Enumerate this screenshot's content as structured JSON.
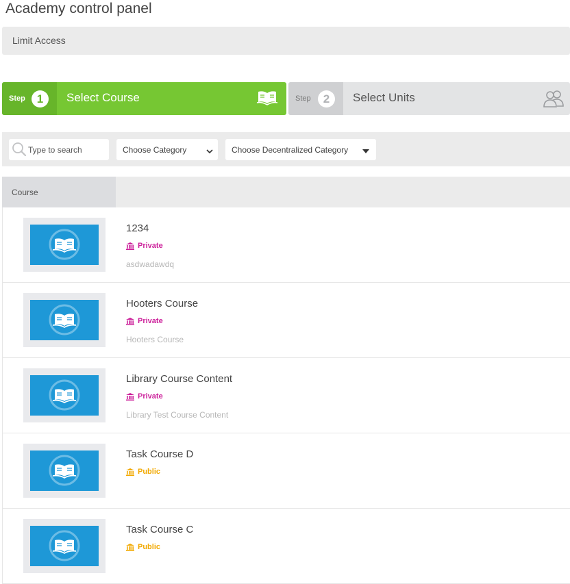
{
  "page": {
    "title": "Academy control panel"
  },
  "section": {
    "label": "Limit Access"
  },
  "steps": [
    {
      "word": "Step",
      "number": "1",
      "label": "Select Course",
      "icon": "open-book-icon",
      "active": true
    },
    {
      "word": "Step",
      "number": "2",
      "label": "Select Units",
      "icon": "users-icon",
      "active": false
    }
  ],
  "filters": {
    "search_placeholder": "Type to search",
    "category_selected": "Choose Category",
    "decentralized_selected": "Choose Decentralized Category"
  },
  "table": {
    "header_course": "Course"
  },
  "courses": [
    {
      "title": "1234",
      "visibility": "Private",
      "subtitle": "asdwadawdq"
    },
    {
      "title": "Hooters Course",
      "visibility": "Private",
      "subtitle": "Hooters Course"
    },
    {
      "title": "Library Course Content",
      "visibility": "Private",
      "subtitle": "Library  Test Course Content"
    },
    {
      "title": "Task Course D",
      "visibility": "Public",
      "subtitle": ""
    },
    {
      "title": "Task Course C",
      "visibility": "Public",
      "subtitle": ""
    }
  ],
  "colors": {
    "step_active": "#76c733",
    "step_inactive": "#e3e4e5",
    "private": "#cc1f9a",
    "public": "#f2a900",
    "thumbnail": "#1e98d7"
  }
}
